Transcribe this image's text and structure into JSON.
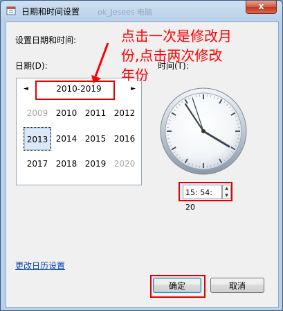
{
  "window": {
    "title": "日期和时间设置",
    "ghost_title": "ok_Jesees 电脑",
    "close_label": "x"
  },
  "labels": {
    "set_datetime": "设置日期和时间:",
    "date": "日期(D):",
    "time": "时间(T):"
  },
  "calendar": {
    "header": "2010-2019",
    "prev": "◄",
    "next": "►",
    "years": [
      {
        "label": "2009",
        "dim": true
      },
      {
        "label": "2010",
        "dim": false
      },
      {
        "label": "2011",
        "dim": false
      },
      {
        "label": "2012",
        "dim": false
      },
      {
        "label": "2013",
        "dim": false,
        "selected": true
      },
      {
        "label": "2014",
        "dim": false
      },
      {
        "label": "2015",
        "dim": false
      },
      {
        "label": "2016",
        "dim": false
      },
      {
        "label": "2017",
        "dim": false
      },
      {
        "label": "2018",
        "dim": false
      },
      {
        "label": "2019",
        "dim": false
      },
      {
        "label": "2020",
        "dim": true
      }
    ]
  },
  "time": {
    "value": "15: 54: 20",
    "up": "▲",
    "down": "▼"
  },
  "links": {
    "change_calendar": "更改日历设置"
  },
  "buttons": {
    "ok": "确定",
    "cancel": "取消"
  },
  "annotation": {
    "line1": "点击一次是修改月",
    "line2": "份,点击两次修改",
    "line3": "年份"
  },
  "colors": {
    "annotation": "#ff0000",
    "link": "#0645ad",
    "selected_bg": "#dbe8f7"
  }
}
